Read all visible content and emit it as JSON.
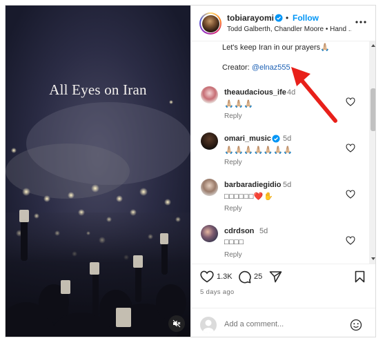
{
  "media": {
    "overlay_text": "All Eyes on Iran",
    "mute_icon": "speaker-muted-icon"
  },
  "post": {
    "username": "tobiarayomi",
    "verified": true,
    "dot": "•",
    "follow_label": "Follow",
    "subline": "Todd Galberth, Chandler Moore • Hand ...",
    "more_icon": "more-horizontal-icon",
    "caption_partial": "Let's keep Iran in our prayers",
    "caption_emoji": "🙏🏼",
    "creator_label": "Creator:",
    "creator_handle": "@elnaz555"
  },
  "comments": [
    {
      "user": "theaudacious_ife",
      "time": "4d",
      "text": "🙏🏼🙏🏼🙏🏼",
      "reply": "Reply",
      "verified": false
    },
    {
      "user": "omari_music",
      "time": "5d",
      "text": "🙏🏼🙏🏼🙏🏼🙏🏼🙏🏼🙏🏼🙏🏼",
      "reply": "Reply",
      "verified": true
    },
    {
      "user": "barbaradiegidio",
      "time": "5d",
      "text": "□□□□□□❤️✋",
      "reply": "Reply",
      "verified": false
    },
    {
      "user": "cdrdson",
      "time": "5d",
      "text": "□□□□",
      "reply": "Reply",
      "verified": false
    }
  ],
  "actions": {
    "like_count": "1.3K",
    "comment_count": "25",
    "time_ago": "5 days ago"
  },
  "add_comment": {
    "placeholder": "Add a comment..."
  },
  "colors": {
    "accent": "#0095f6",
    "annotation_arrow": "#e8201a",
    "media_bg": "#1e1f33"
  }
}
